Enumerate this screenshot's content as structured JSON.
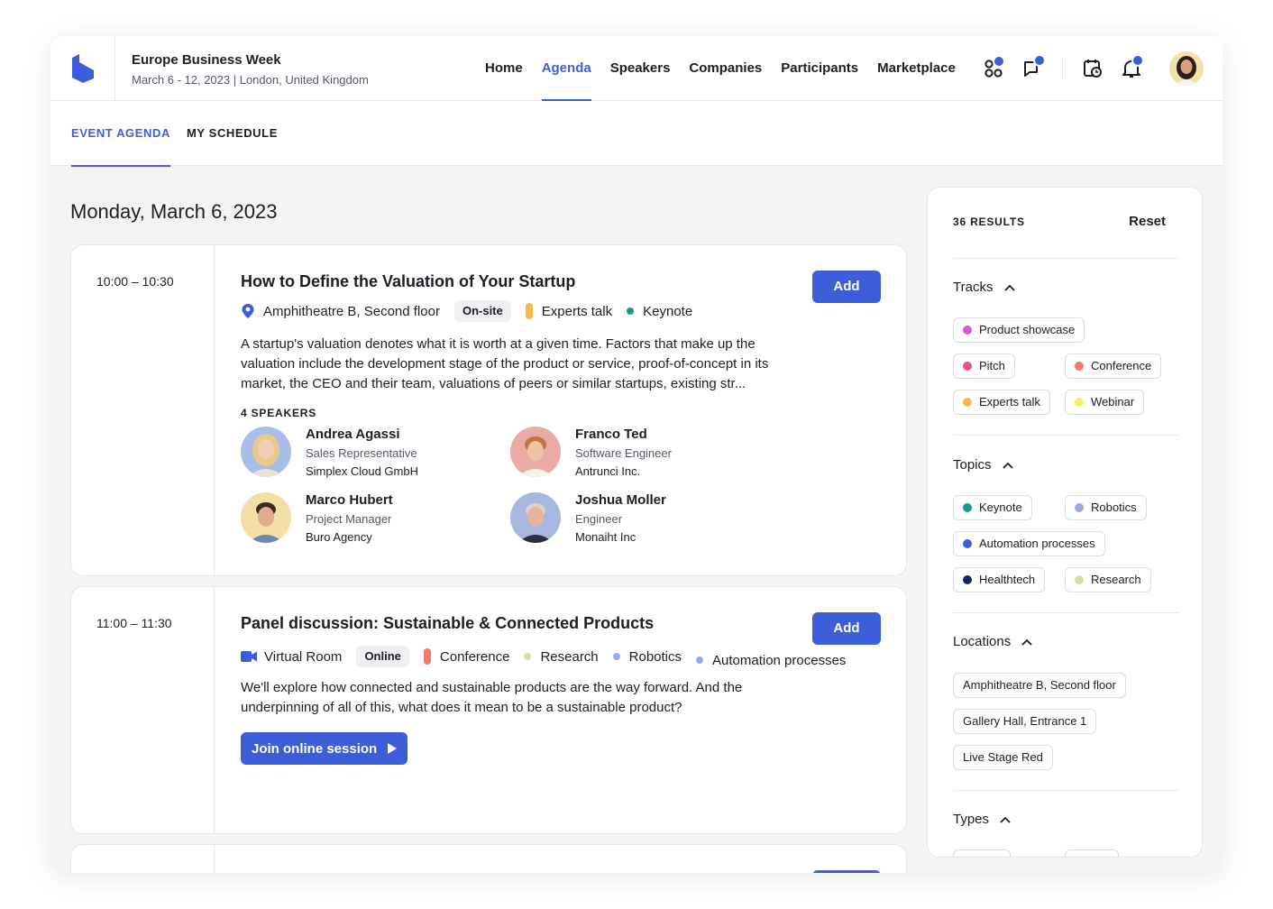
{
  "event": {
    "title": "Europe Business Week",
    "subtitle": "March 6 - 12, 2023 | London, United Kingdom"
  },
  "nav": [
    {
      "label": "Home",
      "active": false
    },
    {
      "label": "Agenda",
      "active": true
    },
    {
      "label": "Speakers",
      "active": false
    },
    {
      "label": "Companies",
      "active": false
    },
    {
      "label": "Participants",
      "active": false
    },
    {
      "label": "Marketplace",
      "active": false
    }
  ],
  "header_icons": [
    "apps-icon",
    "chat-icon",
    "calendar-clock-icon",
    "bell-icon",
    "avatar"
  ],
  "subtabs": [
    {
      "label": "EVENT AGENDA",
      "active": true
    },
    {
      "label": "MY SCHEDULE",
      "active": false
    }
  ],
  "date_heading": "Monday, March 6, 2023",
  "sessions": [
    {
      "time": "10:00 – 10:30",
      "title": "How to Define the Valuation of Your Startup",
      "add_label": "Add",
      "location": "Amphitheatre B, Second floor",
      "mode": "On-site",
      "track": "Experts talk",
      "topics": [
        "Keynote"
      ],
      "description": "A startup's valuation denotes what it is worth at a given time. Factors that make up the valuation include the development stage of the product or service, proof-of-concept in its market, the CEO and their team, valuations of peers or similar startups, existing str...",
      "speakers_label": "4 SPEAKERS",
      "speakers": [
        {
          "name": "Andrea Agassi",
          "role": "Sales Representative",
          "company": "Simplex Cloud GmbH"
        },
        {
          "name": "Franco Ted",
          "role": "Software Engineer",
          "company": "Antrunci Inc."
        },
        {
          "name": "Marco Hubert",
          "role": "Project Manager",
          "company": "Buro Agency"
        },
        {
          "name": "Joshua Moller",
          "role": "Engineer",
          "company": "Monaiht Inc"
        }
      ]
    },
    {
      "time": "11:00 – 11:30",
      "title": "Panel discussion: Sustainable & Connected Products",
      "add_label": "Add",
      "location": "Virtual Room",
      "mode": "Online",
      "track": "Conference",
      "topics": [
        "Research",
        "Robotics",
        "Automation processes"
      ],
      "description": "We'll explore how connected and sustainable products are the way forward. And the underpinning of all of this, what does it mean to be a sustainable product?",
      "join_label": "Join online session"
    }
  ],
  "filters": {
    "results": "36 RESULTS",
    "reset": "Reset",
    "tracks": {
      "label": "Tracks",
      "items": [
        {
          "label": "Product showcase",
          "color": "#d35ad2"
        },
        {
          "label": "Pitch",
          "color": "#ea4f86"
        },
        {
          "label": "Conference",
          "color": "#f27a6a"
        },
        {
          "label": "Experts talk",
          "color": "#f7b84d"
        },
        {
          "label": "Webinar",
          "color": "#f5ee63"
        }
      ]
    },
    "topics": {
      "label": "Topics",
      "items": [
        {
          "label": "Keynote",
          "color": "#119e8f"
        },
        {
          "label": "Robotics",
          "color": "#97a9ee"
        },
        {
          "label": "Automation processes",
          "color": "#3c5fd9"
        },
        {
          "label": "Healthtech",
          "color": "#14285e"
        },
        {
          "label": "Research",
          "color": "#cde4a0"
        }
      ]
    },
    "locations": {
      "label": "Locations",
      "items": [
        {
          "label": "Amphitheatre B, Second floor"
        },
        {
          "label": "Gallery Hall, Entrance 1"
        },
        {
          "label": "Live Stage Red"
        }
      ]
    },
    "types": {
      "label": "Types"
    }
  },
  "colors": {
    "accent": "#3c5fd9",
    "keynote": "#119e8f",
    "experts_talk": "#f7b84d",
    "conference": "#f27a6a",
    "research": "#cde4a0",
    "robotics": "#97a9ee"
  }
}
